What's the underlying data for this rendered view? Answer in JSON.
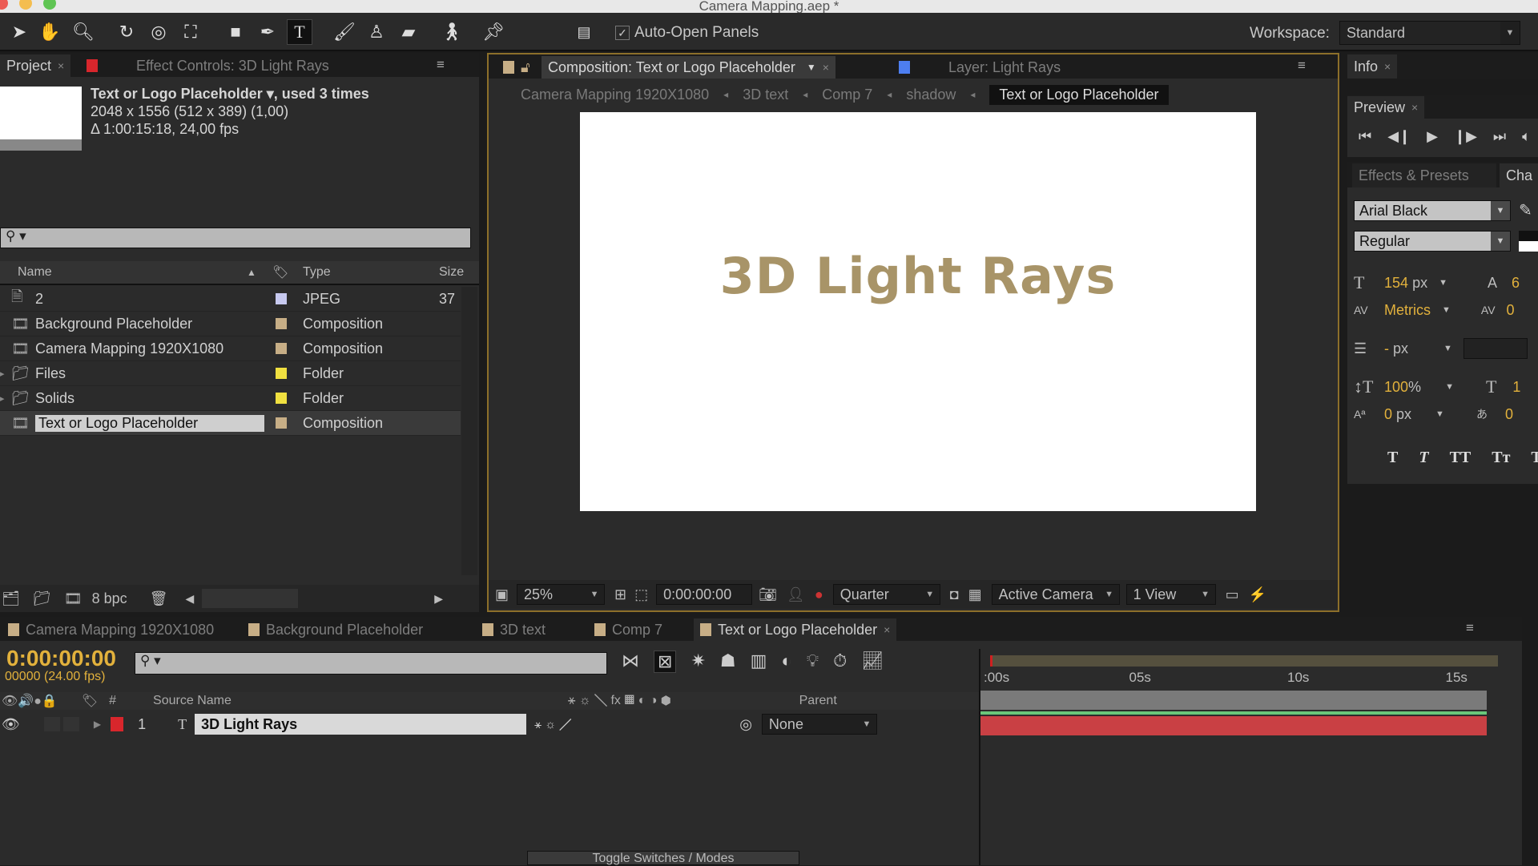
{
  "window": {
    "title": "Camera Mapping.aep *"
  },
  "toolbar": {
    "tools": [
      "selection-tool",
      "hand-tool",
      "zoom-tool",
      "rotation-tool",
      "camera-orbit-tool",
      "pan-behind-tool",
      "rectangle-tool",
      "pen-tool",
      "type-tool",
      "brush-tool",
      "clone-stamp-tool",
      "eraser-tool",
      "roto-brush-tool",
      "puppet-pin-tool"
    ],
    "auto_open_label": "Auto-Open Panels",
    "auto_open_checked": true,
    "workspace_label": "Workspace:",
    "workspace_value": "Standard"
  },
  "project_panel": {
    "tabs": [
      {
        "label": "Project"
      },
      {
        "label": "Effect Controls: 3D Light Rays"
      }
    ],
    "selected_name": "Text or Logo Placeholder ▾",
    "used": ", used 3 times",
    "dimensions": "2048 x 1556  (512 x 389) (1,00)",
    "duration": "Δ 1:00:15:18, 24,00 fps",
    "search_placeholder": "",
    "columns": {
      "name": "Name",
      "type": "Type",
      "size": "Size"
    },
    "items": [
      {
        "name": "2",
        "type": "JPEG",
        "size": "37",
        "icon": "jpeg-file-icon",
        "label_color": "#c7c9ef"
      },
      {
        "name": "Background Placeholder",
        "type": "Composition",
        "size": "",
        "icon": "composition-icon",
        "label_color": "#c7ae86"
      },
      {
        "name": "Camera Mapping 1920X1080",
        "type": "Composition",
        "size": "",
        "icon": "composition-icon",
        "label_color": "#c7ae86"
      },
      {
        "name": "Files",
        "type": "Folder",
        "size": "",
        "icon": "folder-icon",
        "label_color": "#f0e040"
      },
      {
        "name": "Solids",
        "type": "Folder",
        "size": "",
        "icon": "folder-icon",
        "label_color": "#f0e040"
      },
      {
        "name": "Text or Logo Placeholder",
        "type": "Composition",
        "size": "",
        "icon": "composition-icon",
        "label_color": "#c7ae86",
        "selected": true
      }
    ],
    "bpc": "8 bpc"
  },
  "comp_panel": {
    "tab_label": "Composition: Text or Logo Placeholder",
    "layer_tab": "Layer: Light Rays",
    "breadcrumbs": [
      "Camera Mapping 1920X1080",
      "3D text",
      "Comp 7",
      "shadow",
      "Text or Logo Placeholder"
    ],
    "canvas_text": "3D Light Rays",
    "text_color": "#a89468",
    "zoom": "25%",
    "timecode": "0:00:00:00",
    "resolution": "Quarter",
    "camera": "Active Camera",
    "views": "1 View"
  },
  "right_panel": {
    "info_tab": "Info",
    "preview_tab": "Preview",
    "effects_tab": "Effects & Presets",
    "character_tab": "Cha",
    "font": "Arial Black",
    "style": "Regular",
    "font_size": "154",
    "font_size_unit": "px",
    "leading_partial": "6",
    "kerning": "Metrics",
    "tracking_partial": "0",
    "stroke_width": "-",
    "stroke_unit": "px",
    "vscale": "100",
    "vscale_unit": "%",
    "hscale_partial": "1",
    "baseline": "0",
    "baseline_unit": "px",
    "tsume_partial": "0",
    "style_buttons": [
      "T",
      "T",
      "TT",
      "Tт",
      "T"
    ]
  },
  "timeline": {
    "tabs": [
      {
        "label": "Camera Mapping 1920X1080"
      },
      {
        "label": "Background Placeholder"
      },
      {
        "label": "3D text"
      },
      {
        "label": "Comp 7"
      },
      {
        "label": "Text or Logo Placeholder",
        "active": true
      }
    ],
    "timecode": "0:00:00:00",
    "frames": "00000 (24.00 fps)",
    "columns": {
      "num": "#",
      "source": "Source Name",
      "parent": "Parent"
    },
    "layers": [
      {
        "num": "1",
        "name": "3D Light Rays",
        "type": "T",
        "label_color": "#d8262c",
        "parent": "None"
      }
    ],
    "ruler": [
      ":00s",
      "05s",
      "10s",
      "15s"
    ],
    "toggle_label": "Toggle Switches / Modes"
  }
}
